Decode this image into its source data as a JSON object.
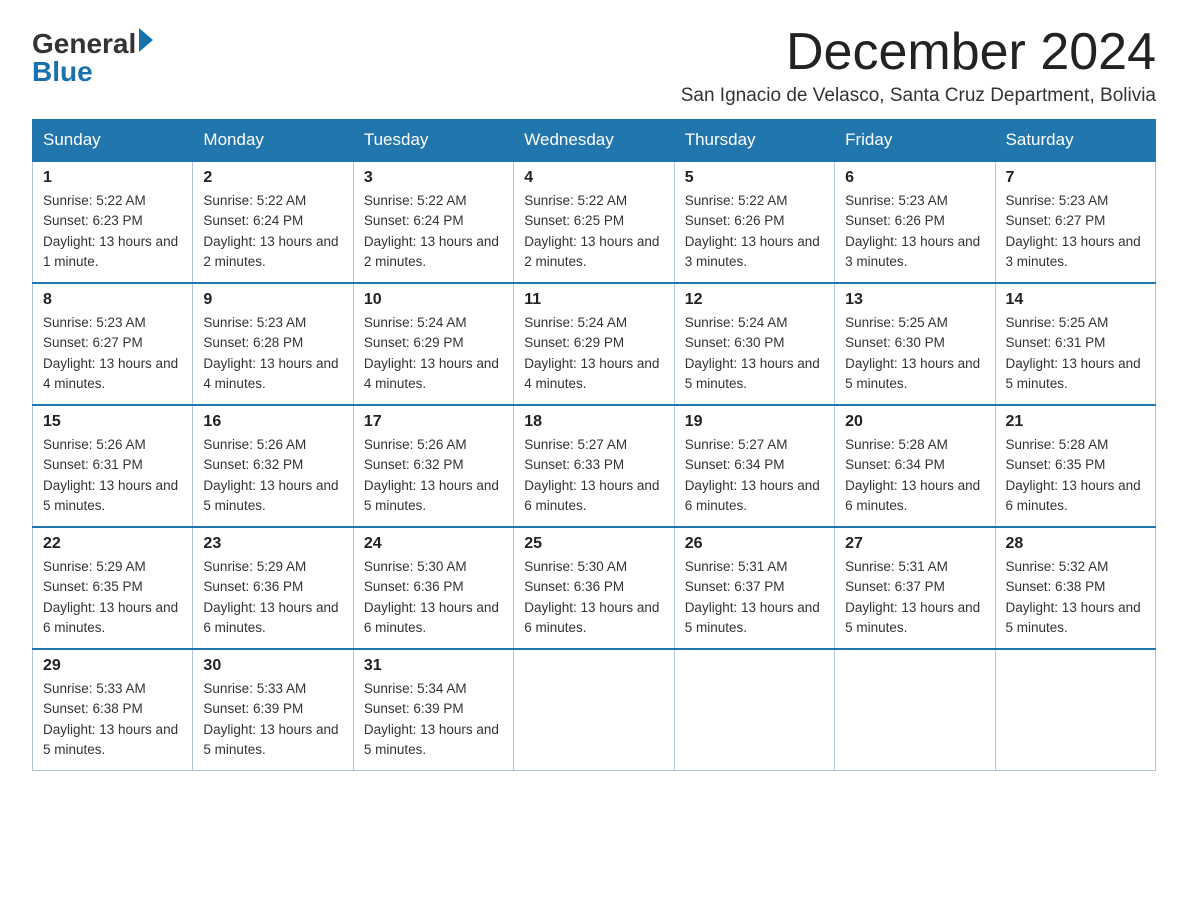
{
  "header": {
    "logo_general": "General",
    "logo_blue": "Blue",
    "month_title": "December 2024",
    "subtitle": "San Ignacio de Velasco, Santa Cruz Department, Bolivia"
  },
  "days_of_week": [
    "Sunday",
    "Monday",
    "Tuesday",
    "Wednesday",
    "Thursday",
    "Friday",
    "Saturday"
  ],
  "weeks": [
    [
      {
        "day": "1",
        "sunrise": "5:22 AM",
        "sunset": "6:23 PM",
        "daylight": "13 hours and 1 minute."
      },
      {
        "day": "2",
        "sunrise": "5:22 AM",
        "sunset": "6:24 PM",
        "daylight": "13 hours and 2 minutes."
      },
      {
        "day": "3",
        "sunrise": "5:22 AM",
        "sunset": "6:24 PM",
        "daylight": "13 hours and 2 minutes."
      },
      {
        "day": "4",
        "sunrise": "5:22 AM",
        "sunset": "6:25 PM",
        "daylight": "13 hours and 2 minutes."
      },
      {
        "day": "5",
        "sunrise": "5:22 AM",
        "sunset": "6:26 PM",
        "daylight": "13 hours and 3 minutes."
      },
      {
        "day": "6",
        "sunrise": "5:23 AM",
        "sunset": "6:26 PM",
        "daylight": "13 hours and 3 minutes."
      },
      {
        "day": "7",
        "sunrise": "5:23 AM",
        "sunset": "6:27 PM",
        "daylight": "13 hours and 3 minutes."
      }
    ],
    [
      {
        "day": "8",
        "sunrise": "5:23 AM",
        "sunset": "6:27 PM",
        "daylight": "13 hours and 4 minutes."
      },
      {
        "day": "9",
        "sunrise": "5:23 AM",
        "sunset": "6:28 PM",
        "daylight": "13 hours and 4 minutes."
      },
      {
        "day": "10",
        "sunrise": "5:24 AM",
        "sunset": "6:29 PM",
        "daylight": "13 hours and 4 minutes."
      },
      {
        "day": "11",
        "sunrise": "5:24 AM",
        "sunset": "6:29 PM",
        "daylight": "13 hours and 4 minutes."
      },
      {
        "day": "12",
        "sunrise": "5:24 AM",
        "sunset": "6:30 PM",
        "daylight": "13 hours and 5 minutes."
      },
      {
        "day": "13",
        "sunrise": "5:25 AM",
        "sunset": "6:30 PM",
        "daylight": "13 hours and 5 minutes."
      },
      {
        "day": "14",
        "sunrise": "5:25 AM",
        "sunset": "6:31 PM",
        "daylight": "13 hours and 5 minutes."
      }
    ],
    [
      {
        "day": "15",
        "sunrise": "5:26 AM",
        "sunset": "6:31 PM",
        "daylight": "13 hours and 5 minutes."
      },
      {
        "day": "16",
        "sunrise": "5:26 AM",
        "sunset": "6:32 PM",
        "daylight": "13 hours and 5 minutes."
      },
      {
        "day": "17",
        "sunrise": "5:26 AM",
        "sunset": "6:32 PM",
        "daylight": "13 hours and 5 minutes."
      },
      {
        "day": "18",
        "sunrise": "5:27 AM",
        "sunset": "6:33 PM",
        "daylight": "13 hours and 6 minutes."
      },
      {
        "day": "19",
        "sunrise": "5:27 AM",
        "sunset": "6:34 PM",
        "daylight": "13 hours and 6 minutes."
      },
      {
        "day": "20",
        "sunrise": "5:28 AM",
        "sunset": "6:34 PM",
        "daylight": "13 hours and 6 minutes."
      },
      {
        "day": "21",
        "sunrise": "5:28 AM",
        "sunset": "6:35 PM",
        "daylight": "13 hours and 6 minutes."
      }
    ],
    [
      {
        "day": "22",
        "sunrise": "5:29 AM",
        "sunset": "6:35 PM",
        "daylight": "13 hours and 6 minutes."
      },
      {
        "day": "23",
        "sunrise": "5:29 AM",
        "sunset": "6:36 PM",
        "daylight": "13 hours and 6 minutes."
      },
      {
        "day": "24",
        "sunrise": "5:30 AM",
        "sunset": "6:36 PM",
        "daylight": "13 hours and 6 minutes."
      },
      {
        "day": "25",
        "sunrise": "5:30 AM",
        "sunset": "6:36 PM",
        "daylight": "13 hours and 6 minutes."
      },
      {
        "day": "26",
        "sunrise": "5:31 AM",
        "sunset": "6:37 PM",
        "daylight": "13 hours and 5 minutes."
      },
      {
        "day": "27",
        "sunrise": "5:31 AM",
        "sunset": "6:37 PM",
        "daylight": "13 hours and 5 minutes."
      },
      {
        "day": "28",
        "sunrise": "5:32 AM",
        "sunset": "6:38 PM",
        "daylight": "13 hours and 5 minutes."
      }
    ],
    [
      {
        "day": "29",
        "sunrise": "5:33 AM",
        "sunset": "6:38 PM",
        "daylight": "13 hours and 5 minutes."
      },
      {
        "day": "30",
        "sunrise": "5:33 AM",
        "sunset": "6:39 PM",
        "daylight": "13 hours and 5 minutes."
      },
      {
        "day": "31",
        "sunrise": "5:34 AM",
        "sunset": "6:39 PM",
        "daylight": "13 hours and 5 minutes."
      },
      null,
      null,
      null,
      null
    ]
  ],
  "labels": {
    "sunrise": "Sunrise:",
    "sunset": "Sunset:",
    "daylight": "Daylight:"
  }
}
